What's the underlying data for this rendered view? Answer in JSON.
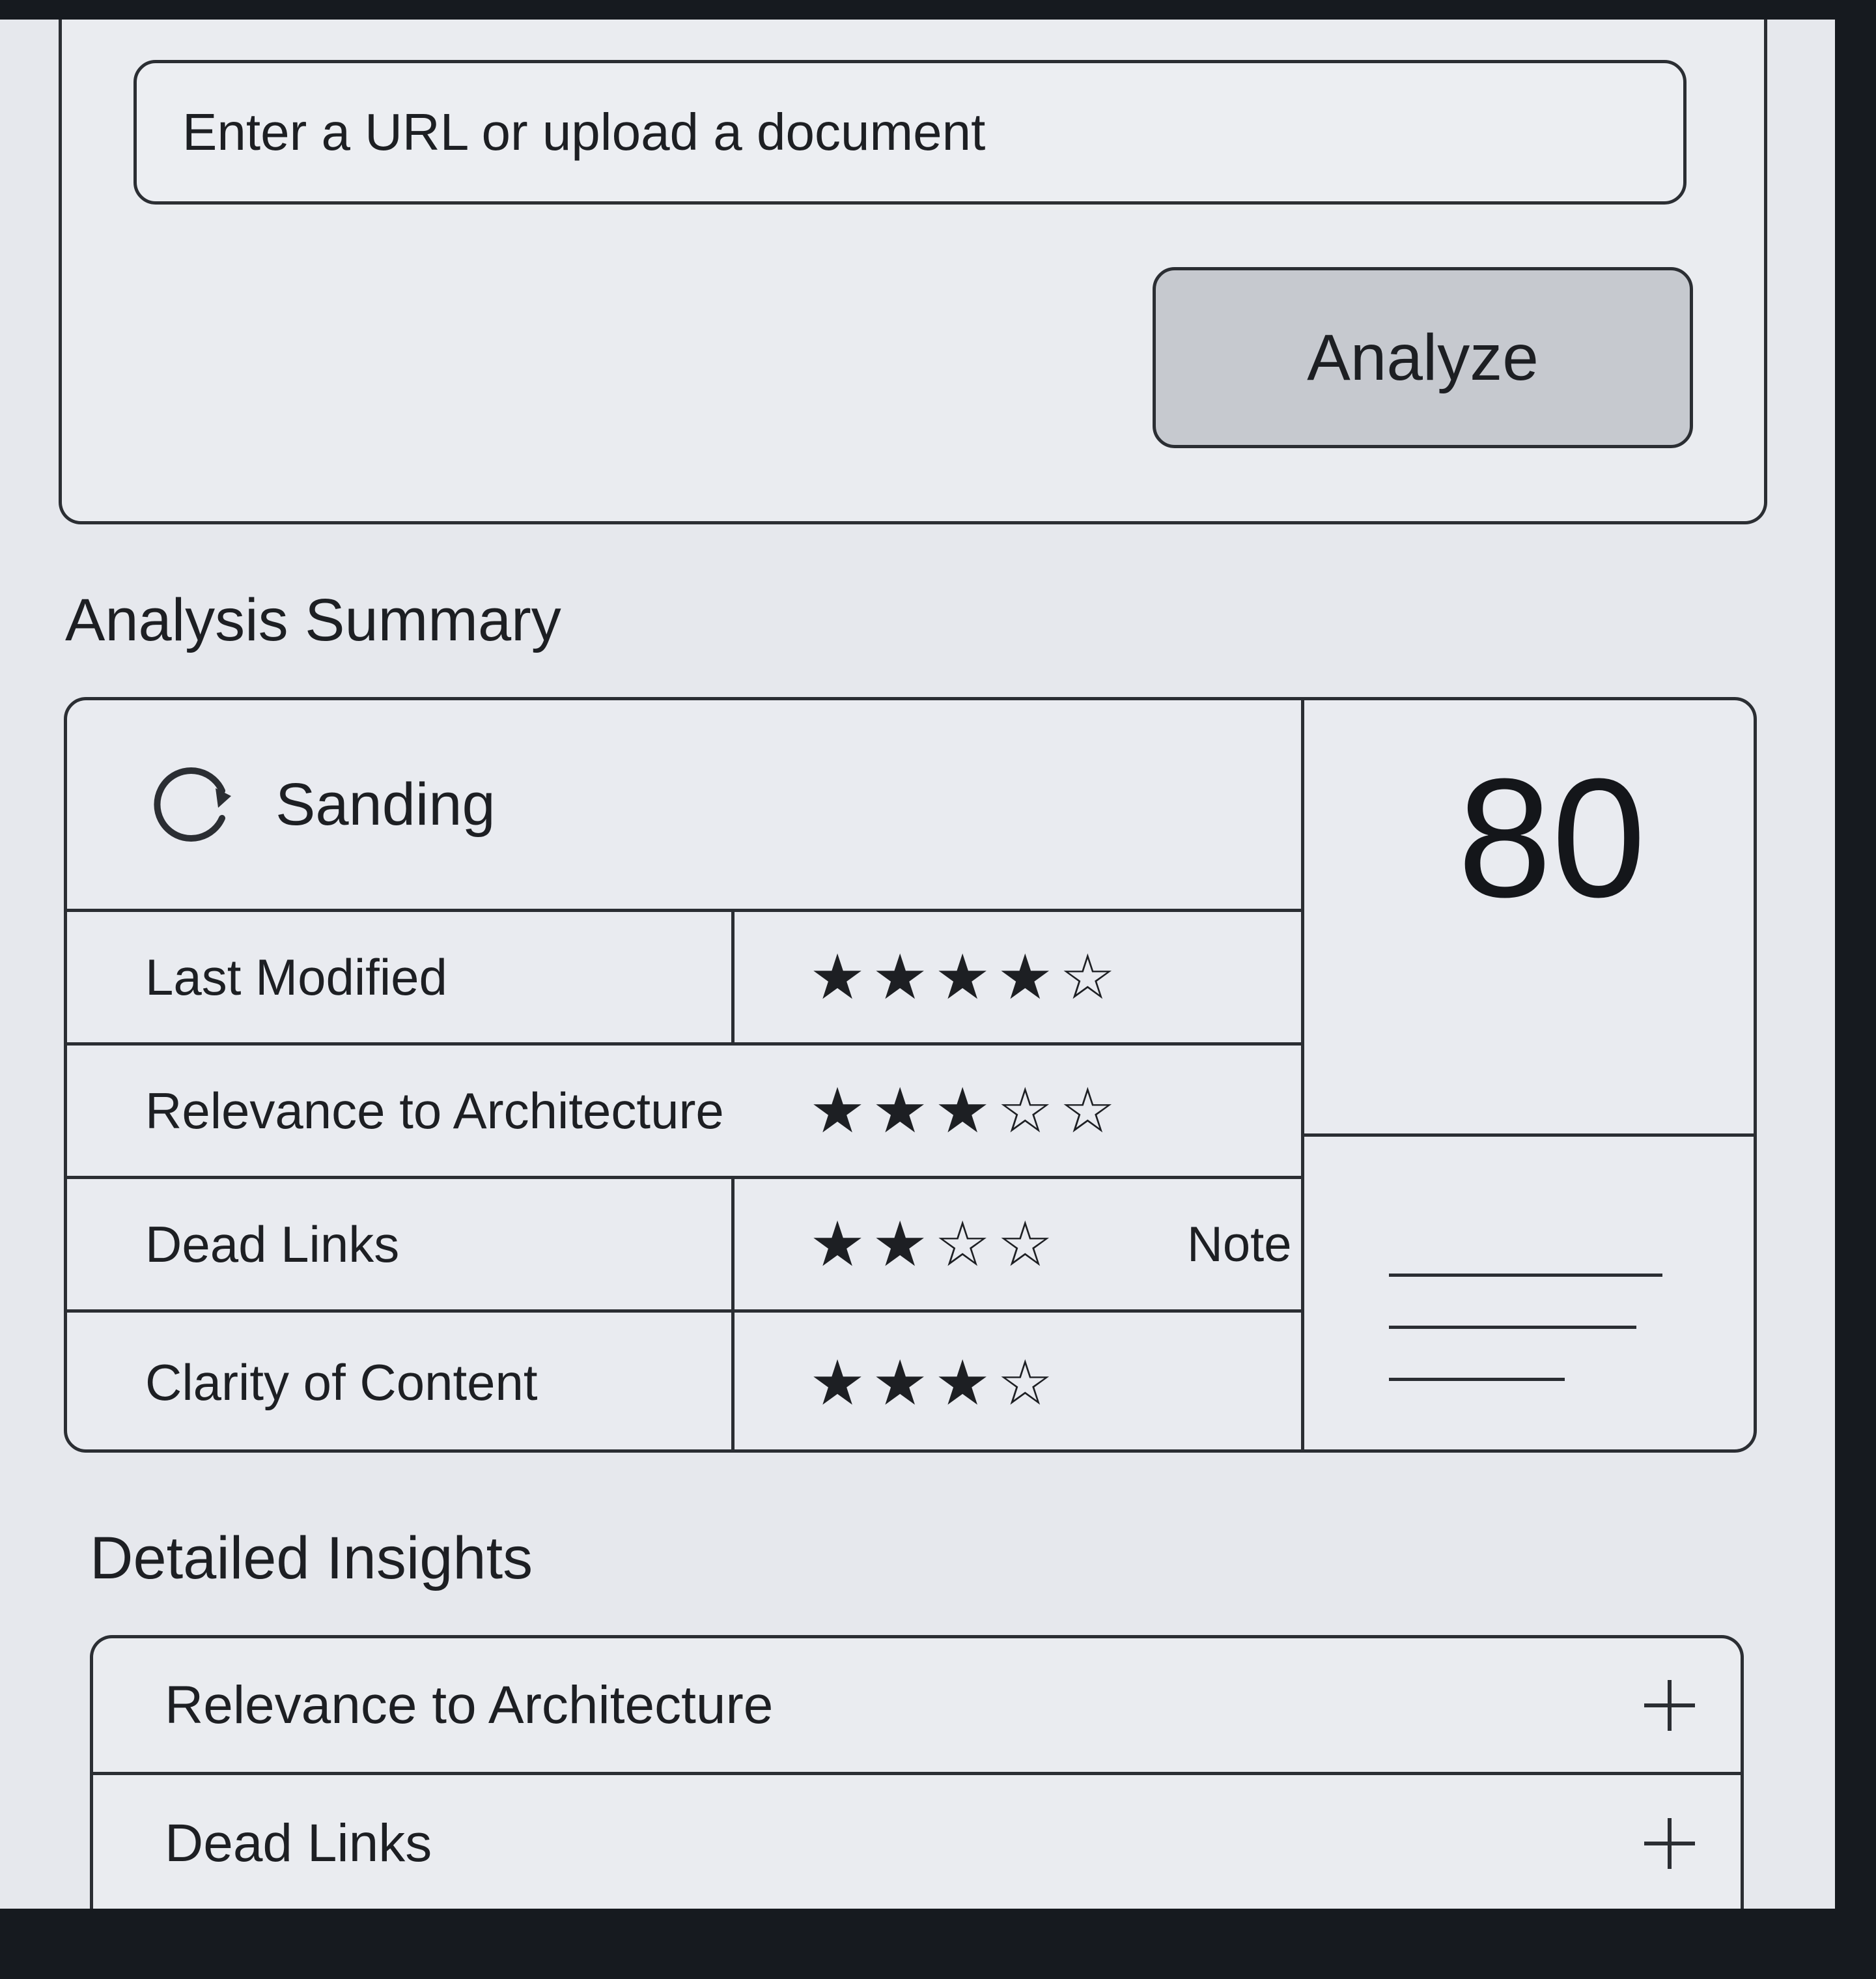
{
  "input": {
    "placeholder": "Enter a URL or upload a document",
    "value": ""
  },
  "analyze_button": {
    "label": "Analyze"
  },
  "summary": {
    "title": "Analysis Summary",
    "status": {
      "label": "Sanding",
      "icon": "refresh-icon"
    },
    "score": "80",
    "metrics": [
      {
        "label": "Last Modified",
        "stars": "★★★★☆",
        "rating": 4,
        "out_of": 5
      },
      {
        "label": "Relevance to Architecture",
        "stars": "★★★☆☆",
        "rating": 3,
        "out_of": 5
      },
      {
        "label": "Dead Links",
        "stars": "★★☆☆",
        "rating": 2,
        "out_of": 4,
        "note": "Note"
      },
      {
        "label": "Clarity of Content",
        "stars": "★★★☆",
        "rating": 3,
        "out_of": 4
      }
    ]
  },
  "insights": {
    "title": "Detailed Insights",
    "items": [
      {
        "label": "Relevance to Architecture",
        "icon": "plus-icon"
      },
      {
        "label": "Dead Links",
        "icon": "plus-icon"
      }
    ]
  },
  "colors": {
    "screen_background": "#e6e8ed",
    "button_fill": "#c6c9cf",
    "border": "#2b2e33",
    "bezel": "#161a1f"
  }
}
